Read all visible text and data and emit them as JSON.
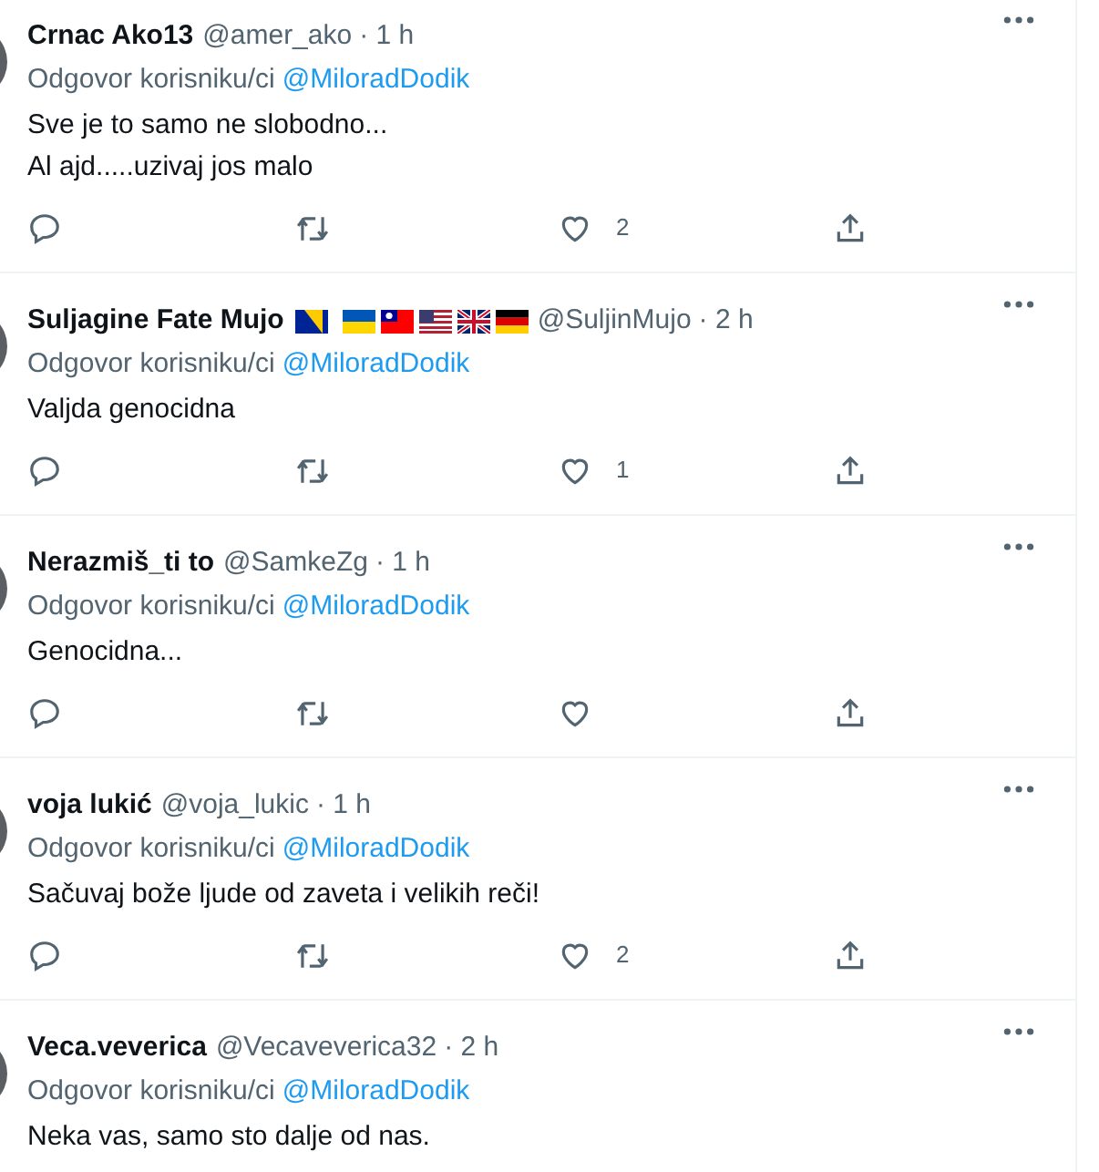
{
  "tweets": [
    {
      "name": "Crnac Ako13",
      "handle": "@amer_ako",
      "time": "· 1 h",
      "reply_label": "Odgovor korisniku/ci",
      "reply_to": "@MiloradDodik",
      "lines": [
        "Sve je to samo ne slobodno...",
        "Al ajd.....uzivaj jos malo"
      ],
      "actions_shown": true,
      "likes": "2"
    },
    {
      "name": "Suljagine Fate Mujo",
      "flags": [
        {
          "kind": "bosnia"
        },
        {
          "kind": "ukraine"
        },
        {
          "kind": "taiwan"
        },
        {
          "kind": "usa"
        },
        {
          "kind": "uk"
        },
        {
          "kind": "germany"
        }
      ],
      "handle": "@SuljinMujo",
      "time": "· 2 h",
      "reply_label": "Odgovor korisniku/ci",
      "reply_to": "@MiloradDodik",
      "lines": [
        "Valjda genocidna"
      ],
      "actions_shown": true,
      "likes": "1"
    },
    {
      "name": "Nerazmiš_ti to",
      "handle": "@SamkeZg",
      "time": "· 1 h",
      "reply_label": "Odgovor korisniku/ci",
      "reply_to": "@MiloradDodik",
      "lines": [
        "Genocidna..."
      ],
      "actions_shown": true
    },
    {
      "name": "voja lukić",
      "handle": "@voja_lukic",
      "time": "· 1 h",
      "reply_label": "Odgovor korisniku/ci",
      "reply_to": "@MiloradDodik",
      "lines": [
        "Sačuvaj bože ljude od zaveta i velikih reči!"
      ],
      "actions_shown": true,
      "likes": "2"
    },
    {
      "name": "Veca.veverica",
      "handle": "@Vecaveverica32",
      "time": "· 2 h",
      "reply_label": "Odgovor korisniku/ci",
      "reply_to": "@MiloradDodik",
      "lines": [
        "Neka vas, samo sto dalje od nas."
      ],
      "actions_shown": false
    }
  ]
}
